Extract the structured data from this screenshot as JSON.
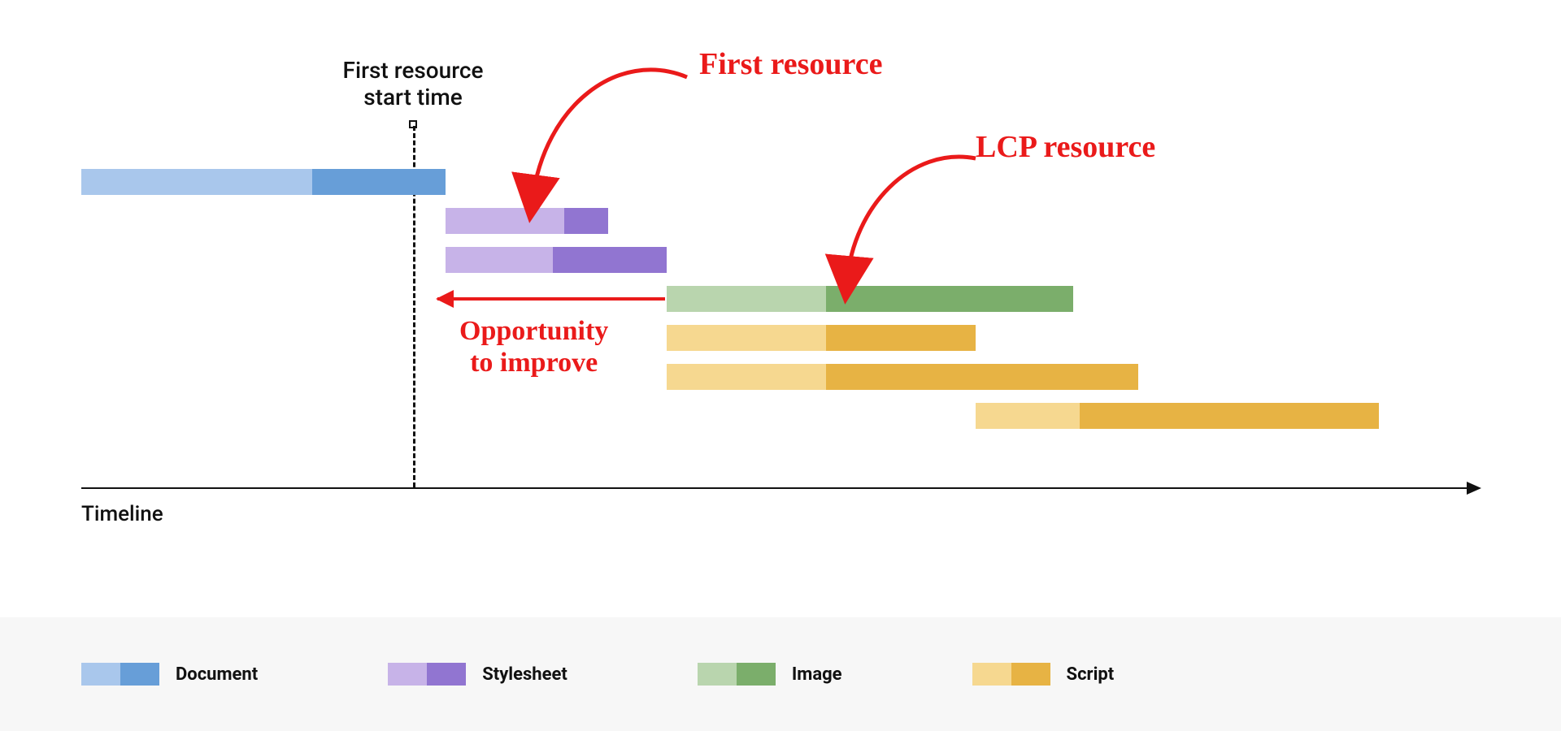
{
  "chart_data": {
    "type": "gantt-waterfall",
    "xunit": "timeline-units",
    "xlim": [
      0,
      1720
    ],
    "marker_x": 408,
    "marker_label_line1": "First resource",
    "marker_label_line2": "start time",
    "axis_label": "Timeline",
    "resources": [
      {
        "name": "document",
        "type": "Document",
        "start": 0,
        "split": 284,
        "end": 448
      },
      {
        "name": "stylesheet-1",
        "type": "Stylesheet",
        "start": 448,
        "split": 594,
        "end": 648
      },
      {
        "name": "stylesheet-2",
        "type": "Stylesheet",
        "start": 448,
        "split": 580,
        "end": 720
      },
      {
        "name": "image-lcp",
        "type": "Image",
        "start": 720,
        "split": 916,
        "end": 1220
      },
      {
        "name": "script-1",
        "type": "Script",
        "start": 720,
        "split": 916,
        "end": 1100
      },
      {
        "name": "script-2",
        "type": "Script",
        "start": 720,
        "split": 916,
        "end": 1300
      },
      {
        "name": "script-3",
        "type": "Script",
        "start": 1100,
        "split": 1228,
        "end": 1596
      }
    ],
    "annotations": {
      "first_resource": "First resource",
      "lcp_resource": "LCP resource",
      "opportunity_line1": "Opportunity",
      "opportunity_line2": "to improve"
    },
    "legend": [
      {
        "label": "Document",
        "light": "#a9c7ec",
        "dark": "#679ed8"
      },
      {
        "label": "Stylesheet",
        "light": "#c7b3e8",
        "dark": "#9175d1"
      },
      {
        "label": "Image",
        "light": "#b9d5ae",
        "dark": "#7bae6b"
      },
      {
        "label": "Script",
        "light": "#f6d890",
        "dark": "#e7b344"
      }
    ],
    "row_tops": [
      138,
      186,
      234,
      282,
      330,
      378,
      426
    ],
    "colors": {
      "Document": {
        "light": "#a9c7ec",
        "dark": "#679ed8"
      },
      "Stylesheet": {
        "light": "#c7b3e8",
        "dark": "#9175d1"
      },
      "Image": {
        "light": "#b9d5ae",
        "dark": "#7bae6b"
      },
      "Script": {
        "light": "#f6d890",
        "dark": "#e7b344"
      }
    },
    "anno_color": "#ea1a1a"
  }
}
